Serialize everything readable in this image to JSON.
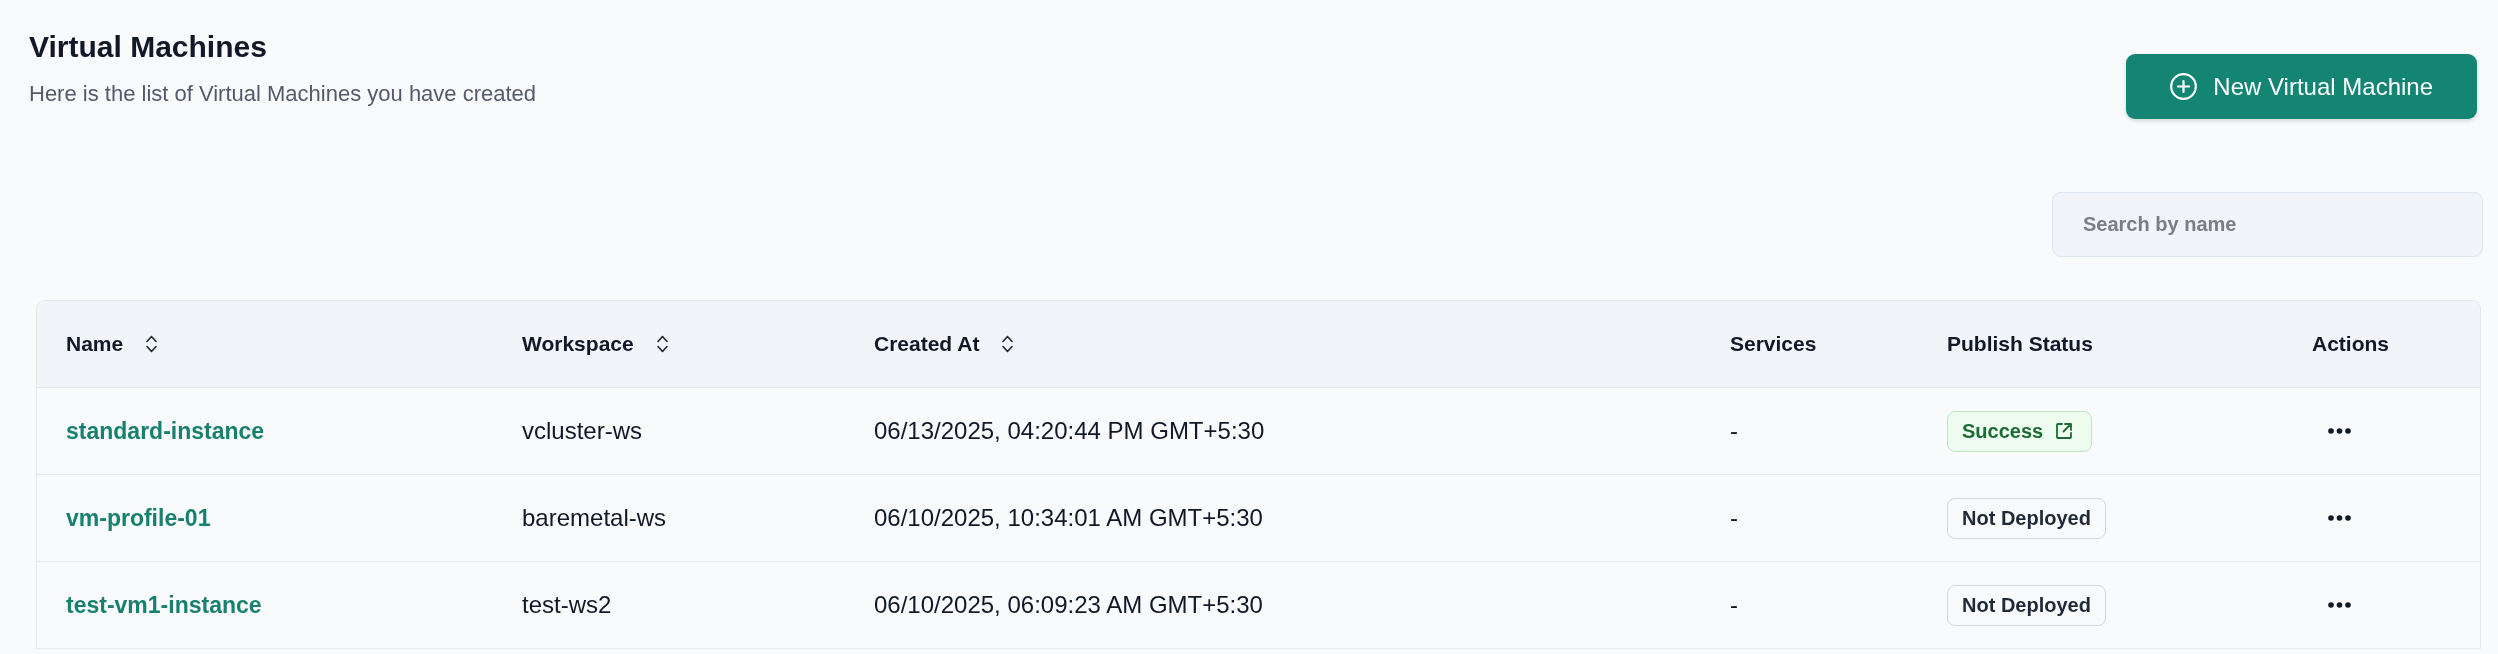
{
  "page": {
    "title": "Virtual Machines",
    "subtitle": "Here is the list of Virtual Machines you have created"
  },
  "new_button": {
    "label": "New Virtual Machine"
  },
  "search": {
    "placeholder": "Search by name"
  },
  "table": {
    "columns": [
      {
        "label": "Name",
        "kind": "sortable"
      },
      {
        "label": "Workspace",
        "kind": "sortable"
      },
      {
        "label": "Created At",
        "kind": "sortable"
      },
      {
        "label": "Services",
        "kind": "plain"
      },
      {
        "label": "Publish Status",
        "kind": "plain"
      },
      {
        "label": "Actions",
        "kind": "plain"
      }
    ],
    "rows": [
      {
        "name": "standard-instance",
        "workspace": "vcluster-ws",
        "created_at": "06/13/2025, 04:20:44 PM GMT+5:30",
        "services": "-",
        "publish_status": {
          "label": "Success",
          "kind": "success",
          "external_link": true
        }
      },
      {
        "name": "vm-profile-01",
        "workspace": "baremetal-ws",
        "created_at": "06/10/2025, 10:34:01 AM GMT+5:30",
        "services": "-",
        "publish_status": {
          "label": "Not Deployed",
          "kind": "neutral",
          "external_link": false
        }
      },
      {
        "name": "test-vm1-instance",
        "workspace": "test-ws2",
        "created_at": "06/10/2025, 06:09:23 AM GMT+5:30",
        "services": "-",
        "publish_status": {
          "label": "Not Deployed",
          "kind": "neutral",
          "external_link": false
        }
      }
    ]
  }
}
